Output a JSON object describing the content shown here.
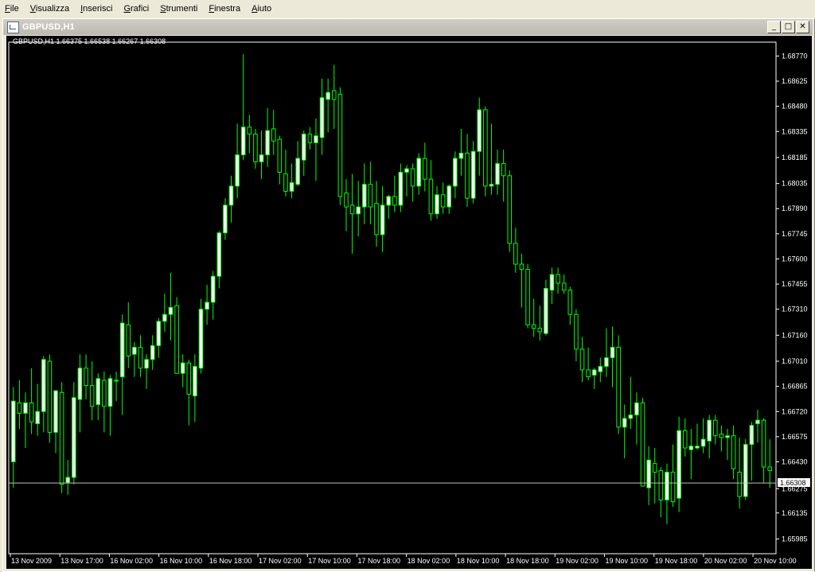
{
  "menu": [
    "File",
    "Visualizza",
    "Inserisci",
    "Grafici",
    "Strumenti",
    "Finestra",
    "Aiuto"
  ],
  "window": {
    "title": "GBPUSD,H1",
    "min_glyph": "_",
    "max_glyph": "□",
    "close_glyph": "✕"
  },
  "chart_info": "GBPUSD,H1  1.66375 1.66538 1.66267 1.66308",
  "current_price_label": "1.66308",
  "colors": {
    "background": "#000000",
    "candle": "#00ff00",
    "bull_body": "#ffffff",
    "bear_body": "#000000",
    "text": "#ffffff",
    "price_line": "#c0c0c0"
  },
  "chart_data": {
    "type": "candlestick",
    "symbol": "GBPUSD",
    "timeframe": "H1",
    "ylim": [
      1.659,
      1.6885
    ],
    "y_ticks": [
      "1.68770",
      "1.68625",
      "1.68480",
      "1.68335",
      "1.68185",
      "1.68035",
      "1.67890",
      "1.67745",
      "1.67600",
      "1.67455",
      "1.67310",
      "1.67160",
      "1.67010",
      "1.66865",
      "1.66720",
      "1.66575",
      "1.66430",
      "1.66275",
      "1.66135",
      "1.65985"
    ],
    "x_ticks": [
      "13 Nov 2009",
      "13 Nov 17:00",
      "16 Nov 02:00",
      "16 Nov 10:00",
      "16 Nov 18:00",
      "17 Nov 02:00",
      "17 Nov 10:00",
      "17 Nov 18:00",
      "18 Nov 02:00",
      "18 Nov 10:00",
      "18 Nov 18:00",
      "19 Nov 02:00",
      "19 Nov 10:00",
      "19 Nov 18:00",
      "20 Nov 02:00",
      "20 Nov 10:00"
    ],
    "last_price": 1.66308,
    "candles": [
      [
        1.6643,
        1.6686,
        1.6628,
        1.6678
      ],
      [
        1.6677,
        1.669,
        1.6662,
        1.6671
      ],
      [
        1.6671,
        1.6683,
        1.6651,
        1.6677
      ],
      [
        1.6677,
        1.6697,
        1.6659,
        1.6666
      ],
      [
        1.6665,
        1.6688,
        1.6658,
        1.6672
      ],
      [
        1.6672,
        1.6704,
        1.666,
        1.6702
      ],
      [
        1.6701,
        1.6705,
        1.6654,
        1.666
      ],
      [
        1.666,
        1.6682,
        1.6648,
        1.6684
      ],
      [
        1.6683,
        1.6689,
        1.6625,
        1.663
      ],
      [
        1.6631,
        1.6644,
        1.6624,
        1.6634
      ],
      [
        1.6634,
        1.6689,
        1.663,
        1.668
      ],
      [
        1.6679,
        1.6705,
        1.666,
        1.6697
      ],
      [
        1.6697,
        1.6705,
        1.6679,
        1.6687
      ],
      [
        1.6687,
        1.6701,
        1.6667,
        1.6675
      ],
      [
        1.6676,
        1.6694,
        1.6667,
        1.6691
      ],
      [
        1.669,
        1.6695,
        1.666,
        1.6675
      ],
      [
        1.6675,
        1.6693,
        1.6658,
        1.6691
      ],
      [
        1.669,
        1.6695,
        1.6678,
        1.669
      ],
      [
        1.6692,
        1.6728,
        1.667,
        1.6723
      ],
      [
        1.6722,
        1.6735,
        1.6697,
        1.6704
      ],
      [
        1.6705,
        1.6712,
        1.6692,
        1.6709
      ],
      [
        1.6709,
        1.6716,
        1.6692,
        1.6697
      ],
      [
        1.6697,
        1.6705,
        1.6685,
        1.6702
      ],
      [
        1.6702,
        1.6716,
        1.6696,
        1.671
      ],
      [
        1.671,
        1.6726,
        1.6703,
        1.6724
      ],
      [
        1.6724,
        1.674,
        1.6718,
        1.6728
      ],
      [
        1.6728,
        1.6752,
        1.6713,
        1.6732
      ],
      [
        1.6733,
        1.6738,
        1.6695,
        1.6694
      ],
      [
        1.6694,
        1.6705,
        1.6686,
        1.67
      ],
      [
        1.67,
        1.6702,
        1.6664,
        1.6682
      ],
      [
        1.6681,
        1.6705,
        1.6666,
        1.6698
      ],
      [
        1.6697,
        1.6737,
        1.6694,
        1.6731
      ],
      [
        1.6731,
        1.6745,
        1.6722,
        1.6735
      ],
      [
        1.6735,
        1.6753,
        1.6725,
        1.675
      ],
      [
        1.675,
        1.6776,
        1.6743,
        1.6775
      ],
      [
        1.6775,
        1.6795,
        1.6771,
        1.6791
      ],
      [
        1.6791,
        1.6808,
        1.6781,
        1.6802
      ],
      [
        1.6802,
        1.6838,
        1.6795,
        1.682
      ],
      [
        1.682,
        1.6878,
        1.6817,
        1.6836
      ],
      [
        1.6836,
        1.6843,
        1.6821,
        1.6832
      ],
      [
        1.6832,
        1.6835,
        1.6812,
        1.6816
      ],
      [
        1.6816,
        1.6834,
        1.6806,
        1.682
      ],
      [
        1.682,
        1.6847,
        1.6813,
        1.6834
      ],
      [
        1.6835,
        1.6846,
        1.682,
        1.6828
      ],
      [
        1.6829,
        1.6831,
        1.6803,
        1.681
      ],
      [
        1.6809,
        1.6823,
        1.6796,
        1.6799
      ],
      [
        1.6799,
        1.6815,
        1.6795,
        1.6804
      ],
      [
        1.6803,
        1.6828,
        1.6802,
        1.6818
      ],
      [
        1.6817,
        1.6834,
        1.6808,
        1.6832
      ],
      [
        1.6832,
        1.6836,
        1.6823,
        1.6827
      ],
      [
        1.6827,
        1.6841,
        1.6805,
        1.6831
      ],
      [
        1.683,
        1.6864,
        1.682,
        1.6853
      ],
      [
        1.6852,
        1.6864,
        1.6833,
        1.6856
      ],
      [
        1.6857,
        1.6872,
        1.6835,
        1.6852
      ],
      [
        1.6855,
        1.6859,
        1.6791,
        1.6796
      ],
      [
        1.6798,
        1.6806,
        1.6776,
        1.679
      ],
      [
        1.6791,
        1.6809,
        1.6763,
        1.6786
      ],
      [
        1.6786,
        1.6805,
        1.6773,
        1.679
      ],
      [
        1.679,
        1.6815,
        1.678,
        1.6803
      ],
      [
        1.6803,
        1.6816,
        1.678,
        1.679
      ],
      [
        1.6792,
        1.6805,
        1.6767,
        1.6774
      ],
      [
        1.6774,
        1.6802,
        1.6764,
        1.6791
      ],
      [
        1.6791,
        1.6797,
        1.6783,
        1.6796
      ],
      [
        1.6796,
        1.6808,
        1.6787,
        1.6791
      ],
      [
        1.6791,
        1.6815,
        1.6787,
        1.681
      ],
      [
        1.681,
        1.6814,
        1.6796,
        1.6812
      ],
      [
        1.6812,
        1.6815,
        1.6793,
        1.6802
      ],
      [
        1.6802,
        1.6821,
        1.6797,
        1.6818
      ],
      [
        1.6818,
        1.6827,
        1.6799,
        1.6806
      ],
      [
        1.6806,
        1.6817,
        1.6782,
        1.6786
      ],
      [
        1.6786,
        1.6802,
        1.6783,
        1.6797
      ],
      [
        1.6797,
        1.6804,
        1.6786,
        1.679
      ],
      [
        1.679,
        1.6803,
        1.6786,
        1.6802
      ],
      [
        1.6802,
        1.6822,
        1.6795,
        1.6818
      ],
      [
        1.6818,
        1.6835,
        1.6808,
        1.6821
      ],
      [
        1.6821,
        1.6832,
        1.679,
        1.6795
      ],
      [
        1.6795,
        1.6828,
        1.6792,
        1.6822
      ],
      [
        1.6822,
        1.6853,
        1.6808,
        1.6846
      ],
      [
        1.6846,
        1.6848,
        1.6796,
        1.6802
      ],
      [
        1.6802,
        1.6838,
        1.6797,
        1.6803
      ],
      [
        1.6803,
        1.6823,
        1.6797,
        1.6815
      ],
      [
        1.6815,
        1.6823,
        1.6793,
        1.6808
      ],
      [
        1.6808,
        1.6811,
        1.6764,
        1.6769
      ],
      [
        1.6769,
        1.6778,
        1.6752,
        1.6757
      ],
      [
        1.6757,
        1.6763,
        1.6732,
        1.6754
      ],
      [
        1.6754,
        1.6757,
        1.672,
        1.6722
      ],
      [
        1.6722,
        1.6737,
        1.6715,
        1.672
      ],
      [
        1.672,
        1.6733,
        1.6713,
        1.6718
      ],
      [
        1.6717,
        1.6748,
        1.6716,
        1.6743
      ],
      [
        1.6742,
        1.6755,
        1.6734,
        1.6751
      ],
      [
        1.6751,
        1.6755,
        1.674,
        1.6746
      ],
      [
        1.6746,
        1.6751,
        1.674,
        1.6742
      ],
      [
        1.6742,
        1.6744,
        1.6722,
        1.6728
      ],
      [
        1.6728,
        1.6731,
        1.6701,
        1.6708
      ],
      [
        1.6708,
        1.6715,
        1.6689,
        1.6696
      ],
      [
        1.6696,
        1.6709,
        1.669,
        1.6692
      ],
      [
        1.6693,
        1.6697,
        1.6685,
        1.6696
      ],
      [
        1.6695,
        1.6703,
        1.6689,
        1.6698
      ],
      [
        1.6698,
        1.672,
        1.6692,
        1.6703
      ],
      [
        1.6703,
        1.6721,
        1.6686,
        1.6709
      ],
      [
        1.6709,
        1.6716,
        1.6659,
        1.6663
      ],
      [
        1.6663,
        1.6676,
        1.6645,
        1.6668
      ],
      [
        1.6668,
        1.6692,
        1.6662,
        1.667
      ],
      [
        1.667,
        1.6683,
        1.6653,
        1.6677
      ],
      [
        1.6677,
        1.668,
        1.6629,
        1.6629
      ],
      [
        1.6628,
        1.6652,
        1.6618,
        1.6644
      ],
      [
        1.6642,
        1.6651,
        1.6619,
        1.6637
      ],
      [
        1.6638,
        1.664,
        1.6611,
        1.6621
      ],
      [
        1.6621,
        1.6642,
        1.6607,
        1.6637
      ],
      [
        1.6637,
        1.6653,
        1.6617,
        1.662
      ],
      [
        1.6622,
        1.6669,
        1.6614,
        1.6661
      ],
      [
        1.6661,
        1.6668,
        1.6646,
        1.6651
      ],
      [
        1.665,
        1.6662,
        1.6633,
        1.6652
      ],
      [
        1.6651,
        1.6665,
        1.665,
        1.6652
      ],
      [
        1.6652,
        1.6668,
        1.6648,
        1.6656
      ],
      [
        1.6655,
        1.667,
        1.6645,
        1.6667
      ],
      [
        1.6667,
        1.667,
        1.6653,
        1.6658
      ],
      [
        1.6659,
        1.6664,
        1.6649,
        1.6657
      ],
      [
        1.6657,
        1.6662,
        1.6644,
        1.6658
      ],
      [
        1.6658,
        1.6664,
        1.6633,
        1.6639
      ],
      [
        1.6637,
        1.6657,
        1.6616,
        1.6623
      ],
      [
        1.6623,
        1.6656,
        1.6621,
        1.6653
      ],
      [
        1.6653,
        1.6666,
        1.6632,
        1.6664
      ],
      [
        1.6665,
        1.6673,
        1.6654,
        1.6667
      ],
      [
        1.6667,
        1.6668,
        1.6631,
        1.664
      ],
      [
        1.664,
        1.6656,
        1.6628,
        1.6638
      ]
    ]
  }
}
